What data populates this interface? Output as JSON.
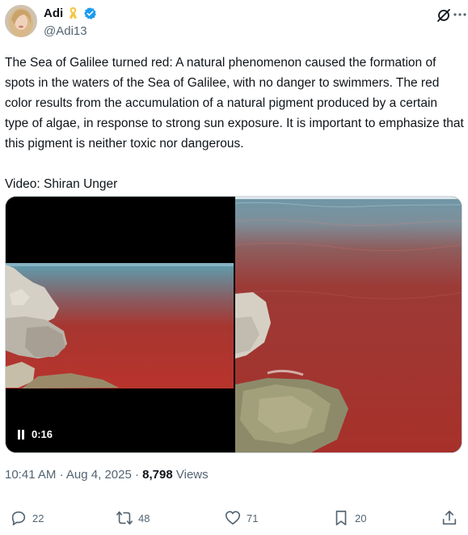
{
  "user": {
    "display_name": "Adi",
    "handle": "@Adi13"
  },
  "tweet": {
    "text": "The Sea of Galilee turned red: A natural phenomenon caused the formation of spots in the waters of the Sea of Galilee, with no danger to swimmers. The red color results from the accumulation of a natural pigment produced by a certain type of algae, in response to strong sun exposure. It is important to emphasize that this pigment is neither toxic nor dangerous.\n\nVideo: Shiran Unger"
  },
  "media": {
    "video_duration": "0:16"
  },
  "meta": {
    "time": "10:41 AM",
    "separator": "·",
    "date": "Aug 4, 2025",
    "views_count": "8,798",
    "views_label": "Views"
  },
  "actions": {
    "replies": "22",
    "reposts": "48",
    "likes": "71",
    "bookmarks": "20"
  },
  "colors": {
    "verified": "#1d9bf0",
    "ribbon": "#f5c542",
    "muted": "#536471",
    "text": "#0f1419"
  },
  "icons": [
    "ribbon-icon",
    "verified-icon",
    "grok-icon",
    "more-icon",
    "pause-icon",
    "reply-icon",
    "repost-icon",
    "like-icon",
    "bookmark-icon",
    "share-icon"
  ]
}
